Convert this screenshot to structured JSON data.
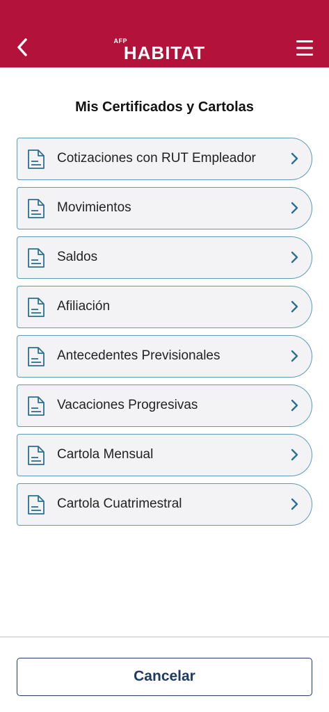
{
  "header": {
    "logo_small": "AFP",
    "logo_main": "HABITAT",
    "back_icon": "chevron-left-icon",
    "menu_icon": "hamburger-menu-icon"
  },
  "page": {
    "title": "Mis Certificados y Cartolas"
  },
  "items": [
    {
      "label": "Cotizaciones con RUT Empleador"
    },
    {
      "label": "Movimientos"
    },
    {
      "label": "Saldos"
    },
    {
      "label": "Afiliación"
    },
    {
      "label": "Antecedentes Previsionales"
    },
    {
      "label": "Vacaciones Progresivas"
    },
    {
      "label": "Cartola Mensual"
    },
    {
      "label": "Cartola Cuatrimestral"
    }
  ],
  "footer": {
    "cancel_label": "Cancelar"
  },
  "colors": {
    "header_bg": "#b3123a",
    "item_border": "#5a9db8",
    "item_bg": "#f3f3f5",
    "icon_color": "#2a6f93",
    "button_border": "#1f3b63"
  }
}
